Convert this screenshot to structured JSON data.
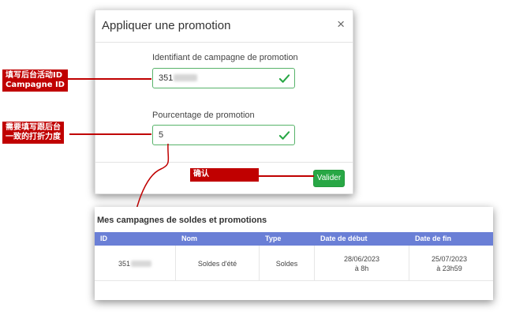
{
  "modal": {
    "title": "Appliquer une promotion",
    "close_label": "×",
    "campaign_id_label": "Identifiant de campagne de promotion",
    "campaign_id_value": "351",
    "percentage_label": "Pourcentage de promotion",
    "percentage_value": "5",
    "submit_label": "Valider"
  },
  "annotations": {
    "campaign_id_line1": "填写后台活动ID",
    "campaign_id_line2": "Campagne ID",
    "discount_line1": "需要填写跟后台",
    "discount_line2": "一致的打折力度",
    "confirm": "确认"
  },
  "campaigns": {
    "title": "Mes campagnes de soldes et promotions",
    "headers": [
      "ID",
      "Nom",
      "Type",
      "Date de début",
      "Date de fin"
    ],
    "row": {
      "id": "351",
      "name": "Soldes d'été",
      "type": "Soldes",
      "start_date": "28/06/2023",
      "start_time": "à 8h",
      "end_date": "25/07/2023",
      "end_time": "à 23h59"
    }
  },
  "colors": {
    "annotation_red": "#c00000",
    "valid_green": "#28a745",
    "table_header": "#6a7fd6"
  }
}
